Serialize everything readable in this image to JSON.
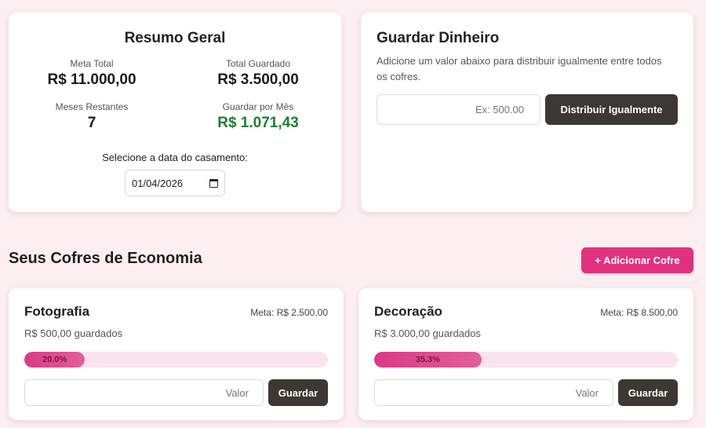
{
  "summary": {
    "title": "Resumo Geral",
    "meta_total_label": "Meta Total",
    "meta_total_value": "R$ 11.000,00",
    "total_guardado_label": "Total Guardado",
    "total_guardado_value": "R$ 3.500,00",
    "meses_label": "Meses Restantes",
    "meses_value": "7",
    "mensal_label": "Guardar por Mês",
    "mensal_value": "R$ 1.071,43",
    "date_label": "Selecione a data do casamento:",
    "date_value": "01/04/2026"
  },
  "guardar": {
    "title": "Guardar Dinheiro",
    "description": "Adicione um valor abaixo para distribuir igualmente entre todos os cofres.",
    "placeholder": "Ex: 500.00",
    "button": "Distribuir Igualmente"
  },
  "section": {
    "title": "Seus Cofres de Economia",
    "add_button": "+ Adicionar Cofre"
  },
  "cofres": [
    {
      "name": "Fotografia",
      "meta": "Meta: R$ 2.500,00",
      "saved": "R$ 500,00 guardados",
      "progress": 0.2,
      "progress_label": "20.0%",
      "placeholder": "Valor",
      "button": "Guardar"
    },
    {
      "name": "Decoração",
      "meta": "Meta: R$ 8.500,00",
      "saved": "R$ 3.000,00 guardados",
      "progress": 0.353,
      "progress_label": "35.3%",
      "placeholder": "Valor",
      "button": "Guardar"
    }
  ],
  "colors": {
    "background": "#fdeef1",
    "accent": "#e0327f",
    "dark_button": "#3d3834",
    "positive": "#1e7e34",
    "progress_track": "#fbe3ee"
  }
}
